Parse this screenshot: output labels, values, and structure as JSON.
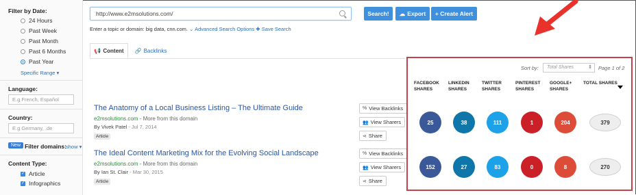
{
  "sidebar": {
    "filter_date_label": "Filter by Date:",
    "date_options": [
      {
        "label": "24 Hours",
        "selected": false
      },
      {
        "label": "Past Week",
        "selected": false
      },
      {
        "label": "Past Month",
        "selected": false
      },
      {
        "label": "Past 6 Months",
        "selected": false
      },
      {
        "label": "Past Year",
        "selected": true
      }
    ],
    "specific_range": "Specific Range ▾",
    "language_label": "Language:",
    "language_placeholder": "E.g French, Español",
    "country_label": "Country:",
    "country_placeholder": "E.g Germany, .de",
    "new_badge": "New",
    "filter_domains_label": "Filter domains:",
    "filter_domains_show": "show ▾",
    "content_type_label": "Content Type:",
    "content_types": [
      "Article",
      "Infographics"
    ]
  },
  "search": {
    "value": "http://www.e2msolutions.com/",
    "search_button": "Search!",
    "export_button": "Export",
    "create_alert_button": "+ Create Alert",
    "helper_text": "Enter a topic or domain: big data, cnn.com.",
    "advanced_link": "Advanced Search Options",
    "save_link": "Save Search"
  },
  "tabs": {
    "content": "Content",
    "backlinks": "Backlinks"
  },
  "sort": {
    "label": "Sort by:",
    "value": "Total Shares",
    "page": "Page 1 of 2"
  },
  "columns": {
    "facebook": "FACEBOOK SHARES",
    "linkedin": "LINKEDIN SHARES",
    "twitter": "TWITTER SHARES",
    "pinterest": "PINTEREST SHARES",
    "google": "GOOGLE+ SHARES",
    "total": "TOTAL SHARES"
  },
  "actions": {
    "view_backlinks": "View Backlinks",
    "view_sharers": "View Sharers",
    "share": "Share"
  },
  "colors": {
    "facebook": "#3b5998",
    "linkedin": "#0e76a8",
    "twitter": "#1da1e8",
    "pinterest": "#cb2027",
    "google": "#dd4b39",
    "panel_border": "#c4434a",
    "arrow": "#e8322b"
  },
  "articles": [
    {
      "title": "The Anatomy of a Local Business Listing – The Ultimate Guide",
      "domain": "e2msolutions.com",
      "more": " - More from this domain",
      "author": "By Vivek Patel",
      "date": " - Jul 7, 2014",
      "tag": "Article",
      "shares": {
        "facebook": "25",
        "linkedin": "38",
        "twitter": "111",
        "pinterest": "1",
        "google": "204",
        "total": "379"
      }
    },
    {
      "title": "The Ideal Content Marketing Mix for the Evolving Social Landscape",
      "domain": "e2msolutions.com",
      "more": " - More from this domain",
      "author": "By Ian St. Clair",
      "date": " - Mar 30, 2015",
      "tag": "Article",
      "shares": {
        "facebook": "152",
        "linkedin": "27",
        "twitter": "83",
        "pinterest": "0",
        "google": "8",
        "total": "270"
      }
    }
  ]
}
